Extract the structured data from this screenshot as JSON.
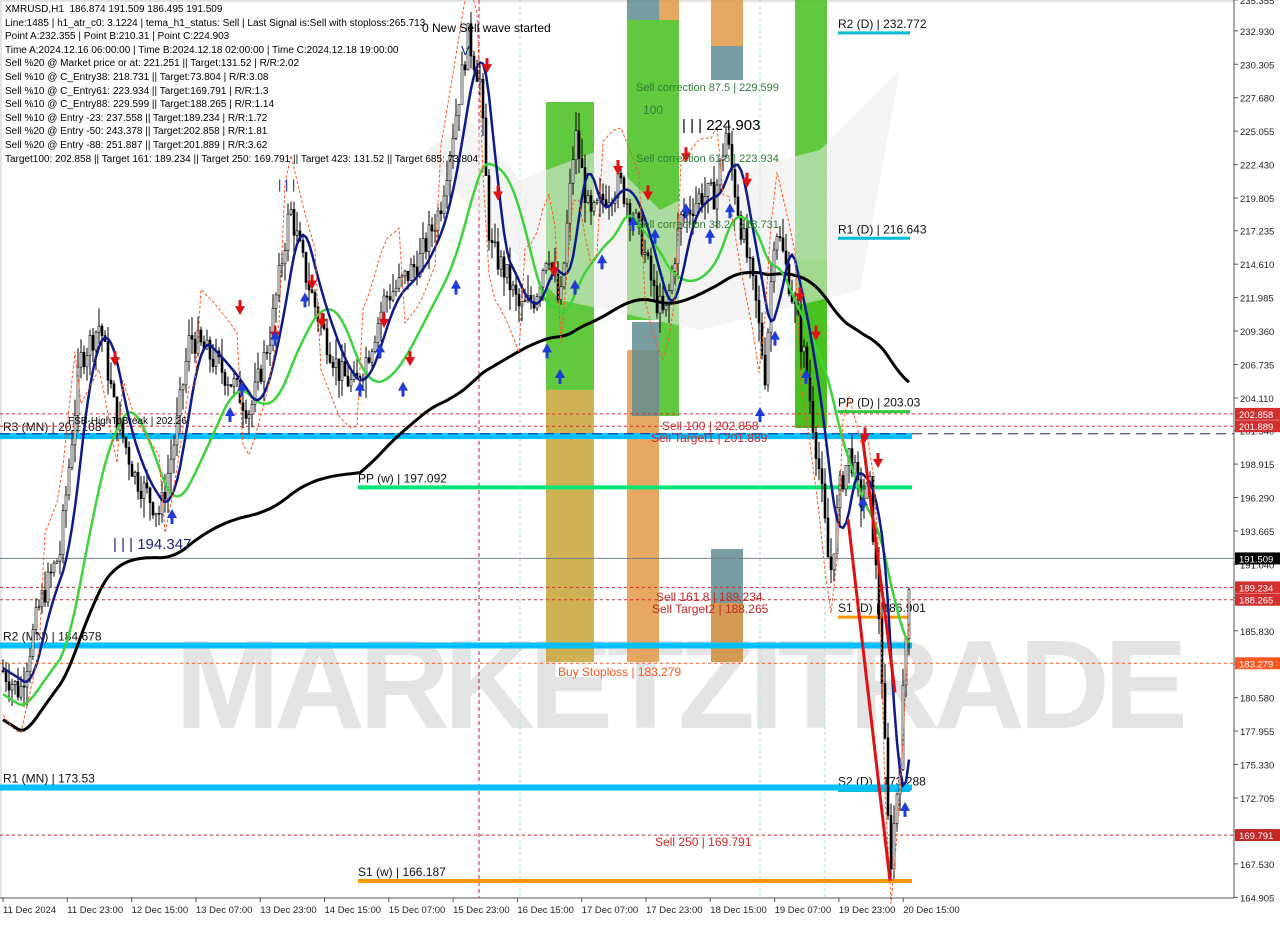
{
  "chart_data": {
    "type": "candlestick",
    "symbol": "XMRUSD",
    "timeframe": "H1",
    "header_ohlc": "186.874 191.509 186.495 191.509",
    "info_lines": [
      "XMRUSD,H1  186.874 191.509 186.495 191.509",
      "Line:1485 | h1_atr_c0: 3.1224 | tema_h1_status: Sell | Last Signal is:Sell with stoploss:265.713",
      "Point A:232.355 | Point B:210.31 | Point C:224.903",
      "Time A:2024.12.16 06:00:00 | Time B:2024.12.18 02:00:00 | Time C:2024.12.18 19:00:00",
      "Sell %20 @ Market price or at: 221.251 || Target:131.52 | R/R:2.02",
      "Sell %10 @ C_Entry38: 218.731 || Target:73.804 | R/R:3.08",
      "Sell %10 @ C_Entry61: 223.934 || Target:169.791 | R/R:1.3",
      "Sell %10 @ C_Entry88: 229.599 || Target:188.265 | R/R:1.14",
      "Sell %10 @ Entry -23: 237.558 || Target:189.234 | R/R:1.72",
      "Sell %20 @ Entry -50: 243.378 || Target:202.858 | R/R:1.81",
      "Sell %20 @ Entry -88: 251.887 || Target:201.889 | R/R:3.62",
      "Target100: 202.858 || Target 161: 189.234 || Target 250: 169.791 || Target 423: 131.52 || Target 685: 73.804"
    ],
    "y_range": [
      164.85,
      235.35
    ],
    "y_ticks": [
      "235.355",
      "232.930",
      "230.305",
      "227.680",
      "225.055",
      "222.430",
      "219.805",
      "217.235",
      "214.610",
      "211.985",
      "209.360",
      "206.735",
      "204.110",
      "201.540",
      "198.915",
      "196.290",
      "193.665",
      "191.040",
      "188.415",
      "185.830",
      "183.205",
      "180.580",
      "177.955",
      "175.330",
      "172.705",
      "170.080",
      "167.530",
      "164.905"
    ],
    "x_ticks": [
      "11 Dec 2024",
      "11 Dec 23:00",
      "12 Dec 15:00",
      "13 Dec 07:00",
      "13 Dec 23:00",
      "14 Dec 15:00",
      "15 Dec 07:00",
      "15 Dec 23:00",
      "16 Dec 15:00",
      "17 Dec 07:00",
      "17 Dec 23:00",
      "18 Dec 15:00",
      "19 Dec 07:00",
      "19 Dec 23:00",
      "20 Dec 15:00"
    ],
    "current_price": "191.509",
    "price_tags": [
      {
        "value": 202.858,
        "label": "202.858",
        "color": "#d32f2f"
      },
      {
        "value": 201.889,
        "label": "201.889",
        "color": "#d32f2f"
      },
      {
        "value": 189.234,
        "label": "189.234",
        "color": "#d32f2f"
      },
      {
        "value": 188.265,
        "label": "188.265",
        "color": "#d32f2f"
      },
      {
        "value": 183.279,
        "label": "183.279",
        "color": "#ff5722"
      },
      {
        "value": 169.791,
        "label": "169.791",
        "color": "#c62828"
      }
    ],
    "pivot_levels": [
      {
        "label": "R2 (D) | 232.772",
        "value": 232.772,
        "color": "#00bcd4"
      },
      {
        "label": "R1 (D) | 216.643",
        "value": 216.643,
        "color": "#00bcd4"
      },
      {
        "label": "PP (D) | 203.03",
        "value": 203.03,
        "color": "#2ecc40"
      },
      {
        "label": "S1 (D) | 186.901",
        "value": 186.901,
        "color": "#ff9800"
      },
      {
        "label": "S2 (D) | 173.288",
        "value": 173.288,
        "color": "#00bcd4"
      },
      {
        "label": "R3 (MN) | 201.108",
        "value": 201.108,
        "color": "#00bfff"
      },
      {
        "label": "R2 (MN) | 184.678",
        "value": 184.678,
        "color": "#00bfff"
      },
      {
        "label": "R1 (MN) | 173.53",
        "value": 173.53,
        "color": "#00bfff"
      },
      {
        "label": "PP (w) | 197.092",
        "value": 197.092,
        "color": "#00e676"
      },
      {
        "label": "S1 (w) | 166.187",
        "value": 166.187,
        "color": "#ff9800"
      }
    ],
    "annotations": [
      {
        "text": "0 New Sell wave started",
        "color": "#000000"
      },
      {
        "text": "Sell correction 87.5 | 229.599",
        "color": "#2e7d32"
      },
      {
        "text": "100",
        "color": "#2e7d32"
      },
      {
        "text": "| | | 224.903",
        "color": "#000000"
      },
      {
        "text": "Sell correction 61.8 | 223.934",
        "color": "#2e7d32"
      },
      {
        "text": "Sell correction 38.2 | 218.731",
        "color": "#2e7d32"
      },
      {
        "text": "FSB-HighToBreak | 202.26",
        "color": "#000000"
      },
      {
        "text": "Sell 100 | 202.858",
        "color": "#c62828"
      },
      {
        "text": "Sell Target1 | 201.889",
        "color": "#c62828"
      },
      {
        "text": "| | | 194.347",
        "color": "#1a237e"
      },
      {
        "text": "Sell 161.8 | 189.234",
        "color": "#c62828"
      },
      {
        "text": "Sell Target2 | 188.265",
        "color": "#c62828"
      },
      {
        "text": "Buy Stoploss | 183.279",
        "color": "#ff5722"
      },
      {
        "text": "Sell 250 | 169.791",
        "color": "#c62828"
      },
      {
        "text": "| | |",
        "color": "#1a237e"
      },
      {
        "text": "V",
        "color": "#1a237e"
      }
    ],
    "watermark": "MARKETZITRADE"
  }
}
